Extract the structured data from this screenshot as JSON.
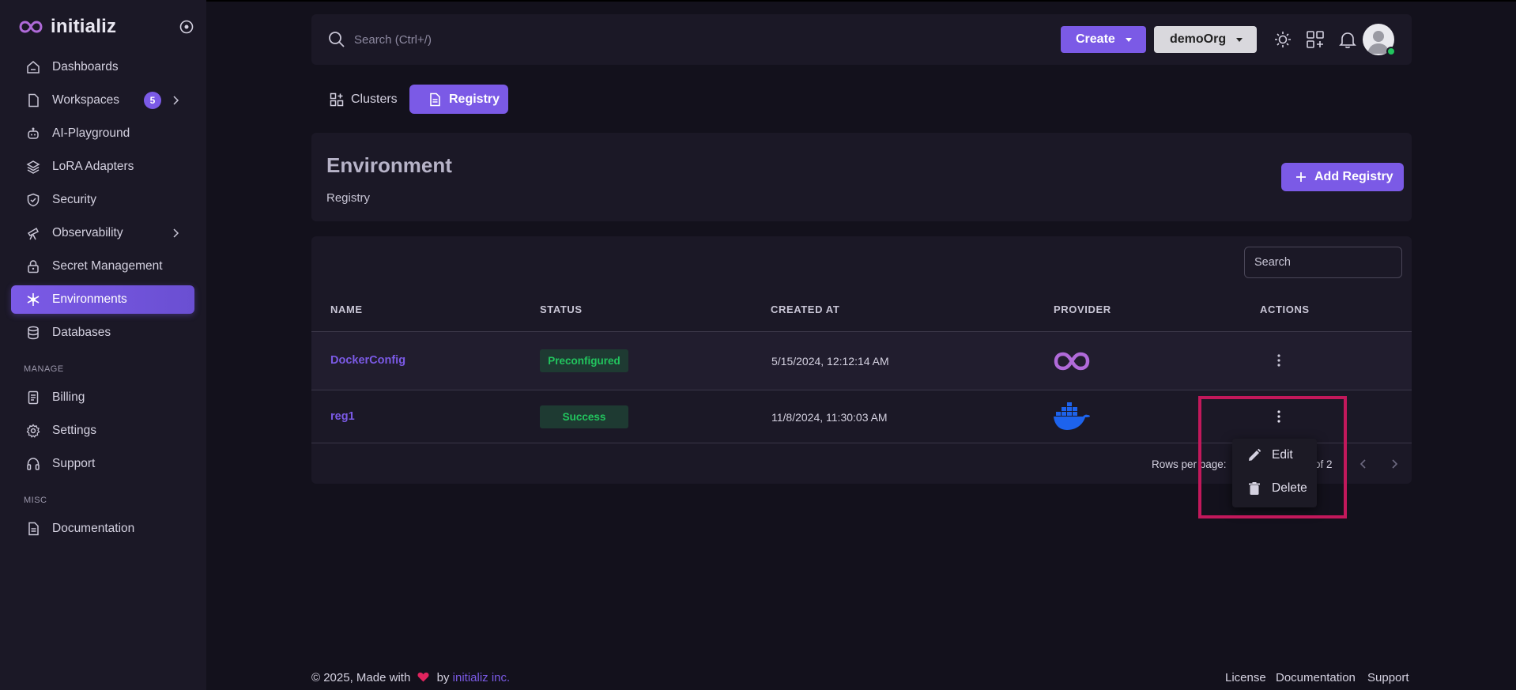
{
  "brand": {
    "name": "initializ"
  },
  "sidebar": {
    "items": [
      {
        "label": "Dashboards"
      },
      {
        "label": "Workspaces",
        "badge": "5"
      },
      {
        "label": "AI-Playground"
      },
      {
        "label": "LoRA Adapters"
      },
      {
        "label": "Security"
      },
      {
        "label": "Observability"
      },
      {
        "label": "Secret Management"
      },
      {
        "label": "Environments"
      },
      {
        "label": "Databases"
      }
    ],
    "manage_label": "MANAGE",
    "manage_items": [
      {
        "label": "Billing"
      },
      {
        "label": "Settings"
      },
      {
        "label": "Support"
      }
    ],
    "misc_label": "MISC",
    "misc_items": [
      {
        "label": "Documentation"
      }
    ]
  },
  "header": {
    "search_placeholder": "Search (Ctrl+/)",
    "create_label": "Create",
    "org_label": "demoOrg"
  },
  "tabs": [
    {
      "label": "Clusters"
    },
    {
      "label": "Registry"
    }
  ],
  "page": {
    "title": "Environment",
    "subtitle": "Registry",
    "add_button": "Add Registry"
  },
  "table": {
    "search_placeholder": "Search",
    "columns": [
      "NAME",
      "STATUS",
      "CREATED AT",
      "PROVIDER",
      "ACTIONS"
    ],
    "rows": [
      {
        "name": "DockerConfig",
        "status": "Preconfigured",
        "created_at": "5/15/2024, 12:12:14 AM",
        "provider": "initializ-logo"
      },
      {
        "name": "reg1",
        "status": "Success",
        "created_at": "11/8/2024, 11:30:03 AM",
        "provider": "docker-logo"
      }
    ],
    "rows_per_page_label": "Rows per page:",
    "page_info": "of 2"
  },
  "menu": {
    "edit_label": "Edit",
    "delete_label": "Delete"
  },
  "footer": {
    "copyright": "© 2025, Made with",
    "by": "by",
    "company": "initializ inc.",
    "links": [
      "License",
      "Documentation",
      "Support"
    ]
  },
  "colors": {
    "accent": "#7b5ae6",
    "background": "#13111c",
    "panel": "#1b1826",
    "success": "#22c55e",
    "highlight": "#c2185b"
  }
}
